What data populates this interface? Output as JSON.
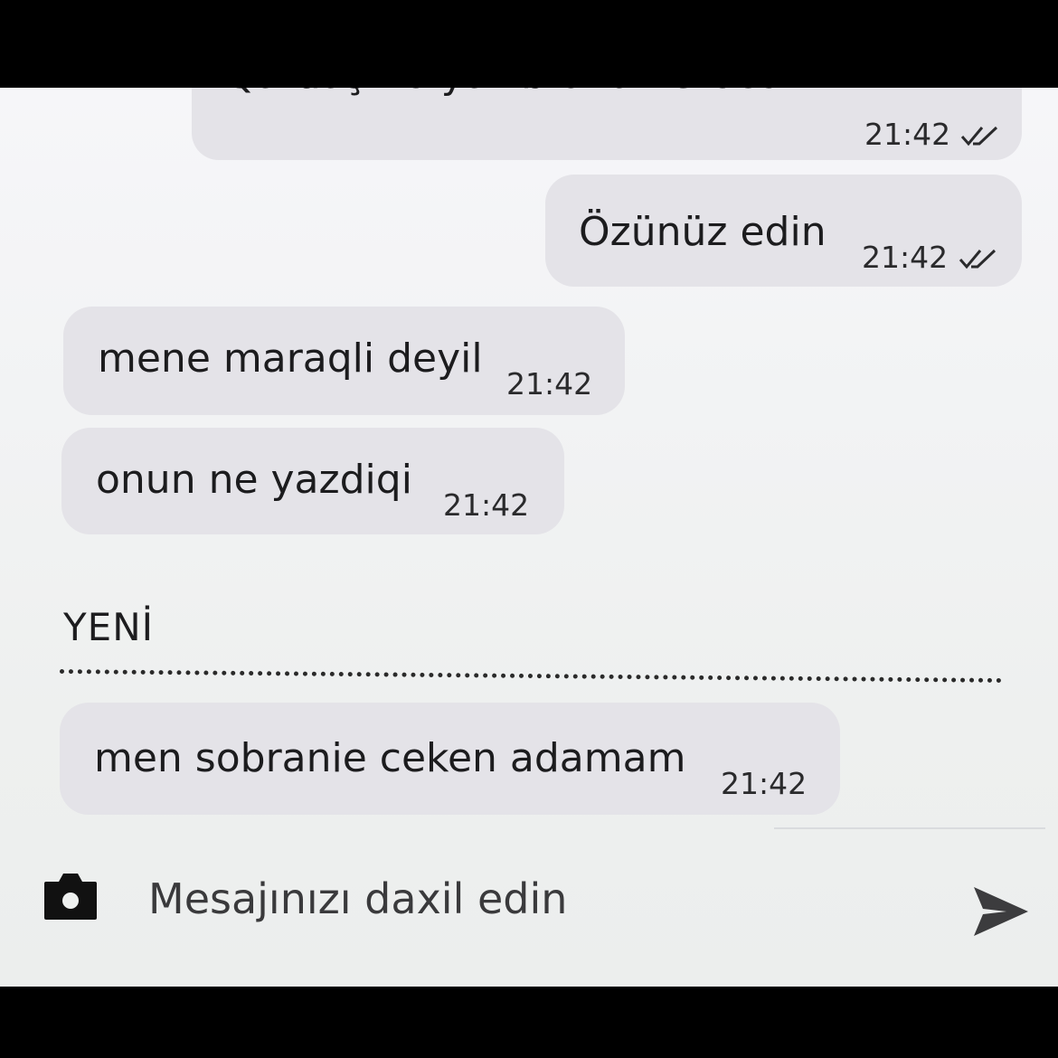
{
  "messages": [
    {
      "text": "Qardaş nə yazıb onu verəcəm",
      "time": "21:42",
      "direction": "outgoing",
      "status_icon": "double-check-icon"
    },
    {
      "text": "Özünüz edin",
      "time": "21:42",
      "direction": "outgoing",
      "status_icon": "double-check-icon"
    },
    {
      "text": "mene maraqli deyil",
      "time": "21:42",
      "direction": "incoming"
    },
    {
      "text": "onun ne yazdiqi",
      "time": "21:42",
      "direction": "incoming"
    },
    {
      "text": "men sobranie ceken adamam",
      "time": "21:42",
      "direction": "incoming"
    }
  ],
  "new_divider": {
    "label": "YENİ"
  },
  "composer": {
    "placeholder": "Mesajınızı daxil edin",
    "camera_icon": "camera-icon",
    "send_icon": "send-icon"
  },
  "colors": {
    "background": "#f1f2f3",
    "bubble": "#e4e3e8",
    "text": "#1c1c1e"
  }
}
